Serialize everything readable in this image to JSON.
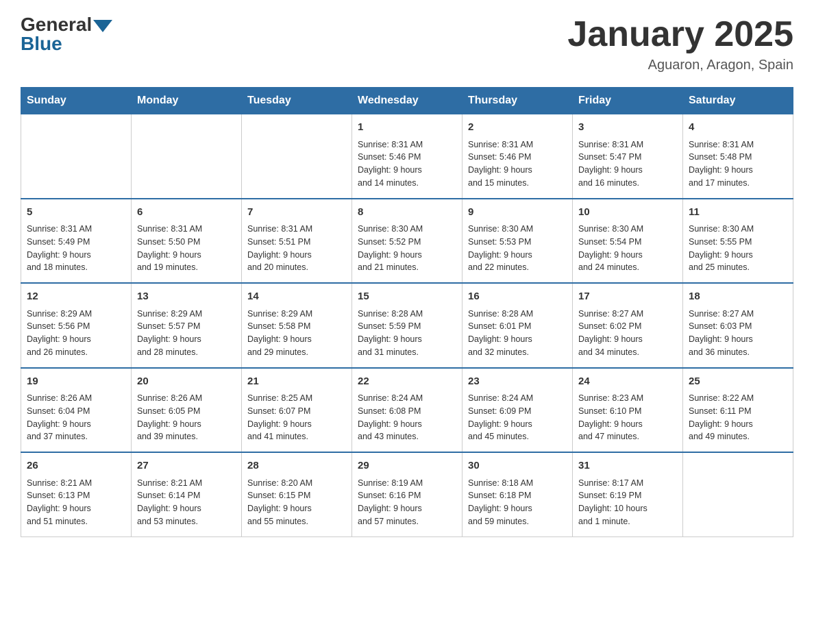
{
  "header": {
    "logo_general": "General",
    "logo_blue": "Blue",
    "title": "January 2025",
    "subtitle": "Aguaron, Aragon, Spain"
  },
  "weekdays": [
    "Sunday",
    "Monday",
    "Tuesday",
    "Wednesday",
    "Thursday",
    "Friday",
    "Saturday"
  ],
  "weeks": [
    [
      {
        "day": "",
        "info": ""
      },
      {
        "day": "",
        "info": ""
      },
      {
        "day": "",
        "info": ""
      },
      {
        "day": "1",
        "info": "Sunrise: 8:31 AM\nSunset: 5:46 PM\nDaylight: 9 hours\nand 14 minutes."
      },
      {
        "day": "2",
        "info": "Sunrise: 8:31 AM\nSunset: 5:46 PM\nDaylight: 9 hours\nand 15 minutes."
      },
      {
        "day": "3",
        "info": "Sunrise: 8:31 AM\nSunset: 5:47 PM\nDaylight: 9 hours\nand 16 minutes."
      },
      {
        "day": "4",
        "info": "Sunrise: 8:31 AM\nSunset: 5:48 PM\nDaylight: 9 hours\nand 17 minutes."
      }
    ],
    [
      {
        "day": "5",
        "info": "Sunrise: 8:31 AM\nSunset: 5:49 PM\nDaylight: 9 hours\nand 18 minutes."
      },
      {
        "day": "6",
        "info": "Sunrise: 8:31 AM\nSunset: 5:50 PM\nDaylight: 9 hours\nand 19 minutes."
      },
      {
        "day": "7",
        "info": "Sunrise: 8:31 AM\nSunset: 5:51 PM\nDaylight: 9 hours\nand 20 minutes."
      },
      {
        "day": "8",
        "info": "Sunrise: 8:30 AM\nSunset: 5:52 PM\nDaylight: 9 hours\nand 21 minutes."
      },
      {
        "day": "9",
        "info": "Sunrise: 8:30 AM\nSunset: 5:53 PM\nDaylight: 9 hours\nand 22 minutes."
      },
      {
        "day": "10",
        "info": "Sunrise: 8:30 AM\nSunset: 5:54 PM\nDaylight: 9 hours\nand 24 minutes."
      },
      {
        "day": "11",
        "info": "Sunrise: 8:30 AM\nSunset: 5:55 PM\nDaylight: 9 hours\nand 25 minutes."
      }
    ],
    [
      {
        "day": "12",
        "info": "Sunrise: 8:29 AM\nSunset: 5:56 PM\nDaylight: 9 hours\nand 26 minutes."
      },
      {
        "day": "13",
        "info": "Sunrise: 8:29 AM\nSunset: 5:57 PM\nDaylight: 9 hours\nand 28 minutes."
      },
      {
        "day": "14",
        "info": "Sunrise: 8:29 AM\nSunset: 5:58 PM\nDaylight: 9 hours\nand 29 minutes."
      },
      {
        "day": "15",
        "info": "Sunrise: 8:28 AM\nSunset: 5:59 PM\nDaylight: 9 hours\nand 31 minutes."
      },
      {
        "day": "16",
        "info": "Sunrise: 8:28 AM\nSunset: 6:01 PM\nDaylight: 9 hours\nand 32 minutes."
      },
      {
        "day": "17",
        "info": "Sunrise: 8:27 AM\nSunset: 6:02 PM\nDaylight: 9 hours\nand 34 minutes."
      },
      {
        "day": "18",
        "info": "Sunrise: 8:27 AM\nSunset: 6:03 PM\nDaylight: 9 hours\nand 36 minutes."
      }
    ],
    [
      {
        "day": "19",
        "info": "Sunrise: 8:26 AM\nSunset: 6:04 PM\nDaylight: 9 hours\nand 37 minutes."
      },
      {
        "day": "20",
        "info": "Sunrise: 8:26 AM\nSunset: 6:05 PM\nDaylight: 9 hours\nand 39 minutes."
      },
      {
        "day": "21",
        "info": "Sunrise: 8:25 AM\nSunset: 6:07 PM\nDaylight: 9 hours\nand 41 minutes."
      },
      {
        "day": "22",
        "info": "Sunrise: 8:24 AM\nSunset: 6:08 PM\nDaylight: 9 hours\nand 43 minutes."
      },
      {
        "day": "23",
        "info": "Sunrise: 8:24 AM\nSunset: 6:09 PM\nDaylight: 9 hours\nand 45 minutes."
      },
      {
        "day": "24",
        "info": "Sunrise: 8:23 AM\nSunset: 6:10 PM\nDaylight: 9 hours\nand 47 minutes."
      },
      {
        "day": "25",
        "info": "Sunrise: 8:22 AM\nSunset: 6:11 PM\nDaylight: 9 hours\nand 49 minutes."
      }
    ],
    [
      {
        "day": "26",
        "info": "Sunrise: 8:21 AM\nSunset: 6:13 PM\nDaylight: 9 hours\nand 51 minutes."
      },
      {
        "day": "27",
        "info": "Sunrise: 8:21 AM\nSunset: 6:14 PM\nDaylight: 9 hours\nand 53 minutes."
      },
      {
        "day": "28",
        "info": "Sunrise: 8:20 AM\nSunset: 6:15 PM\nDaylight: 9 hours\nand 55 minutes."
      },
      {
        "day": "29",
        "info": "Sunrise: 8:19 AM\nSunset: 6:16 PM\nDaylight: 9 hours\nand 57 minutes."
      },
      {
        "day": "30",
        "info": "Sunrise: 8:18 AM\nSunset: 6:18 PM\nDaylight: 9 hours\nand 59 minutes."
      },
      {
        "day": "31",
        "info": "Sunrise: 8:17 AM\nSunset: 6:19 PM\nDaylight: 10 hours\nand 1 minute."
      },
      {
        "day": "",
        "info": ""
      }
    ]
  ]
}
